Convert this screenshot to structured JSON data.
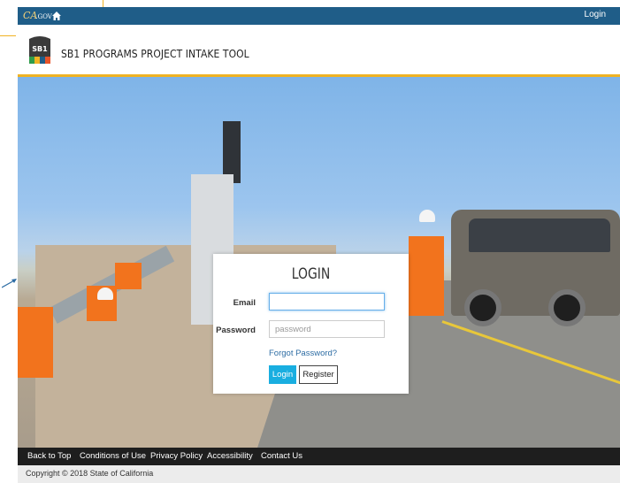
{
  "topbar": {
    "logo_text": "CA",
    "logo_sub": ".GOV",
    "login_label": "Login",
    "icon": "home-icon"
  },
  "header": {
    "badge_text": "SB1",
    "title": "SB1 PROGRAMS PROJECT INTAKE TOOL",
    "accent_color": "#f0b323",
    "icon": "sb1-shield-icon"
  },
  "login": {
    "title": "LOGIN",
    "email_label": "Email",
    "password_label": "Password",
    "email_value": "",
    "password_placeholder": "password",
    "forgot_label": "Forgot Password?",
    "login_button": "Login",
    "register_button": "Register"
  },
  "footer": {
    "links": [
      "Back to Top",
      "Conditions of Use",
      "Privacy Policy",
      "Accessibility",
      "Contact Us"
    ],
    "copyright": "Copyright © 2018 State of California"
  },
  "colors": {
    "topbar": "#1f5d88",
    "login_button": "#19aee0",
    "footer": "#1e1e1e"
  }
}
